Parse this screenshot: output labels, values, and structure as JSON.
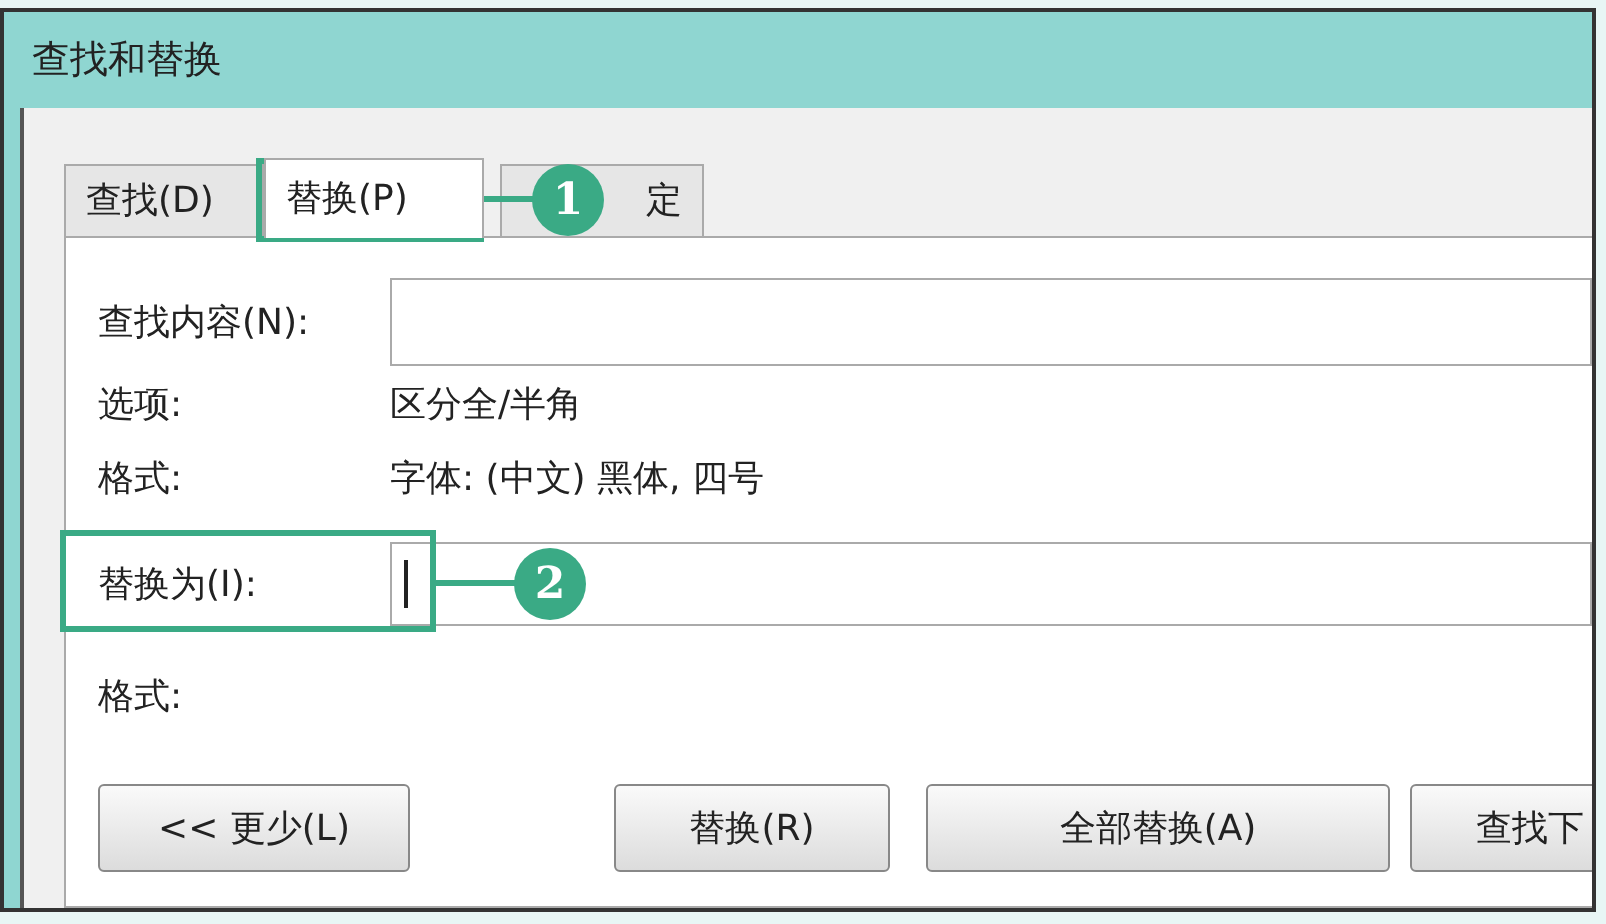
{
  "window": {
    "title": "查找和替换"
  },
  "tabs": [
    {
      "label": "查找(D)",
      "selected": false
    },
    {
      "label": "替换(P)",
      "selected": true
    },
    {
      "label": "定",
      "selected": false
    }
  ],
  "find": {
    "label": "查找内容(N):"
  },
  "options": [
    {
      "label": "选项:",
      "value": "区分全/半角"
    },
    {
      "label": "格式:",
      "value": "字体: (中文) 黑体, 四号"
    }
  ],
  "replace": {
    "label": "替换为(I):",
    "focused": true
  },
  "replace_format": {
    "label": "格式:"
  },
  "buttons": [
    "<< 更少(L)",
    "替换(R)",
    "全部替换(A)",
    "查找下"
  ],
  "callouts": [
    {
      "number": "1"
    },
    {
      "number": "2"
    }
  ]
}
